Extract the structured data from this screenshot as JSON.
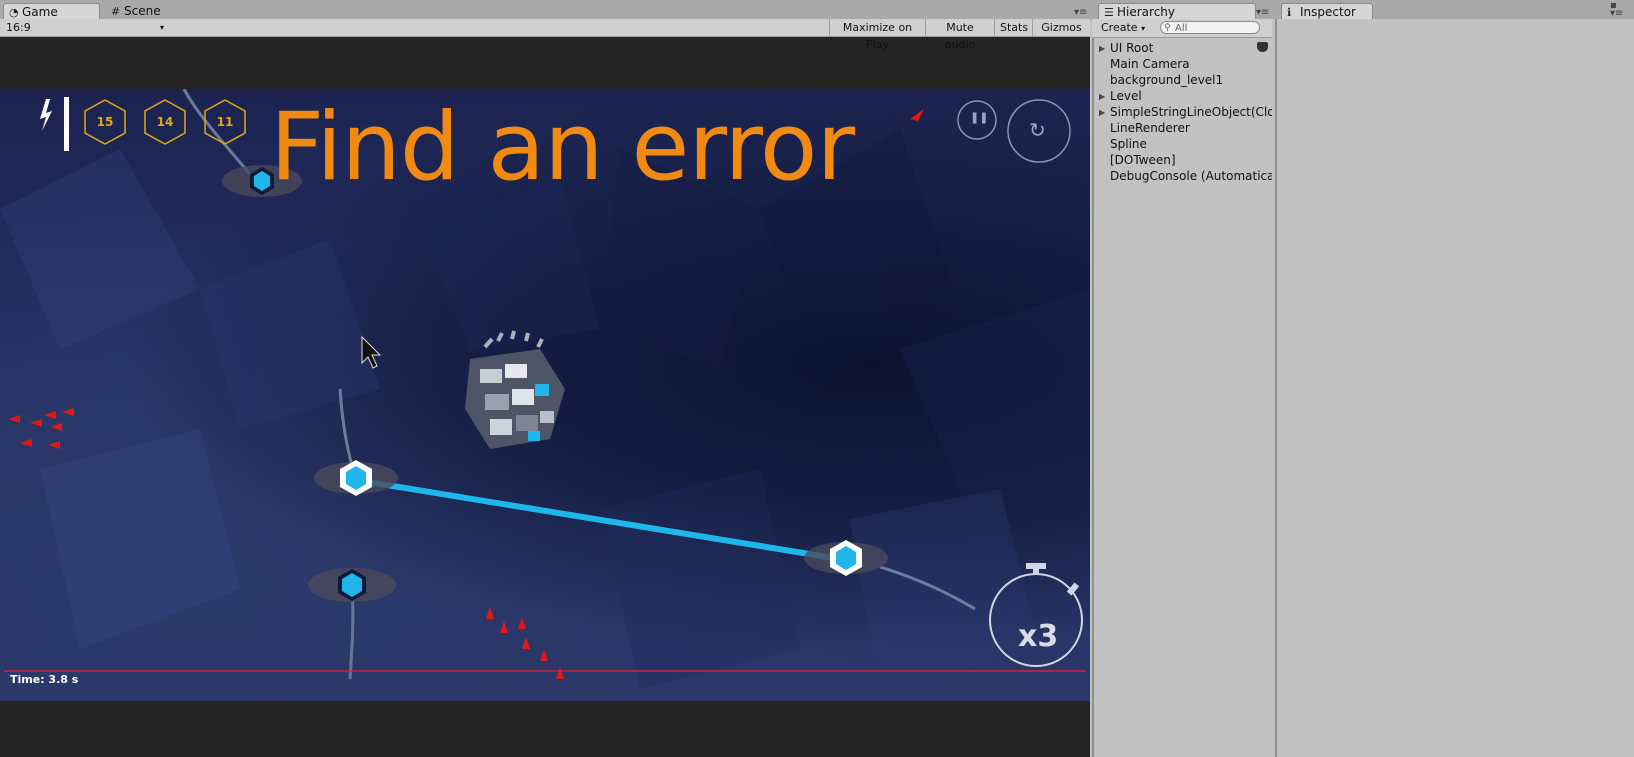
{
  "tabs": {
    "game": "Game",
    "scene": "Scene",
    "hierarchy": "Hierarchy",
    "inspector": "Inspector"
  },
  "game_toolbar": {
    "aspect": "16:9",
    "buttons": [
      "Maximize on Play",
      "Mute audio",
      "Stats",
      "Gizmos"
    ]
  },
  "hud": {
    "overlay_text": "Find an error",
    "scores": [
      "15",
      "14",
      "11"
    ],
    "time": "Time: 3.8 s",
    "multiplier": "x3"
  },
  "hierarchy": {
    "create_label": "Create",
    "search_placeholder": "All",
    "items": [
      "UI Root",
      "Main Camera",
      "background_level1",
      "Level",
      "SimpleStringLineObject(Clone)",
      "LineRenderer",
      "Spline",
      "[DOTween]",
      "DebugConsole (Automatically"
    ]
  },
  "colors": {
    "accent_orange": "#f08a12",
    "node_cyan": "#1fb6ea",
    "score_gold": "#e2a818"
  }
}
